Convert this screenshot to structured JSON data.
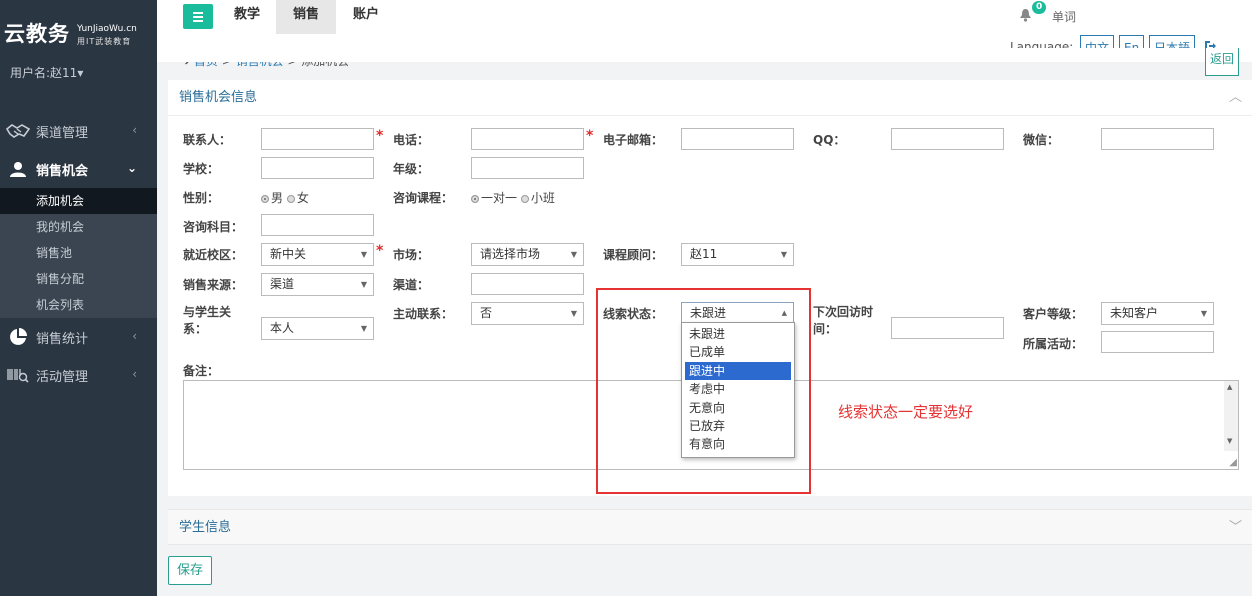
{
  "brand": {
    "name": "云教务",
    "site": "YunJiaoWu.cn",
    "tagline": "用IT武装教育"
  },
  "user": {
    "label": "用户名:赵11",
    "caret": "▾"
  },
  "sidebar": {
    "items": [
      {
        "label": "渠道管理",
        "icon": "handshake-icon"
      },
      {
        "label": "销售机会",
        "icon": "user-icon",
        "open": true
      },
      {
        "label": "销售统计",
        "icon": "pie-chart-icon"
      },
      {
        "label": "活动管理",
        "icon": "barcode-search-icon"
      }
    ],
    "sub_items": [
      "添加机会",
      "我的机会",
      "销售池",
      "销售分配",
      "机会列表"
    ]
  },
  "topnav": {
    "tabs": [
      "教学",
      "销售",
      "账户"
    ],
    "active": "销售"
  },
  "notifications": {
    "count": "0",
    "label": "单词"
  },
  "language": {
    "label": "Language:",
    "options": [
      "中文",
      "En",
      "日本語"
    ]
  },
  "breadcrumb": {
    "home": "首页",
    "sep1": " > ",
    "section": "销售机会",
    "sep2": " > ",
    "current": "添加机会"
  },
  "back_button": "返回",
  "section1": {
    "title": "销售机会信息"
  },
  "form": {
    "contact": "联系人：",
    "phone": "电话：",
    "email": "电子邮箱：",
    "qq": "QQ：",
    "wechat": "微信：",
    "school": "学校：",
    "grade": "年级：",
    "gender": "性别：",
    "gender_male": "男",
    "gender_female": "女",
    "course_type": "咨询课程：",
    "course_one": "一对一",
    "course_group": "小班",
    "subject": "咨询科目：",
    "campus": "就近校区：",
    "campus_value": "新中关",
    "market": "市场：",
    "market_value": "请选择市场",
    "advisor": "课程顾问：",
    "advisor_value": "赵11",
    "source": "销售来源：",
    "source_value": "渠道",
    "channel": "渠道：",
    "relation": "与学生关系：",
    "relation_line1": "与学生关",
    "relation_line2": "系：",
    "relation_value": "本人",
    "active_contact": "主动联系：",
    "active_contact_value": "否",
    "lead_status": "线索状态：",
    "lead_status_value": "未跟进",
    "next_visit_line1": "下次回访时",
    "next_visit_line2": "间：",
    "customer_level": "客户等级：",
    "customer_level_value": "未知客户",
    "activity": "所属活动：",
    "remarks": "备注："
  },
  "lead_status_options": [
    "未跟进",
    "已成单",
    "跟进中",
    "考虑中",
    "无意向",
    "已放弃",
    "有意向"
  ],
  "lead_status_highlighted": "跟进中",
  "annotation": "线索状态一定要选好",
  "section2": {
    "title": "学生信息"
  },
  "save_button": "保存"
}
